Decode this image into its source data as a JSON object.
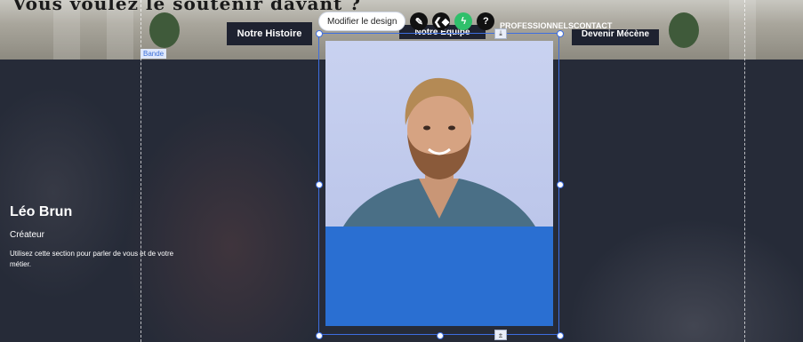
{
  "hero": {
    "title": "Vous voulez le soutenir davant ?"
  },
  "nav": {
    "history_label": "Notre Histoire",
    "team_label": "Notre Equipe",
    "pros_label": "PROFESSIONNELS",
    "contact_label": "CONTACT",
    "patron_label": "Devenir Mécène"
  },
  "editor": {
    "band_label": "Bande",
    "modify_design_label": "Modifier le design",
    "icons": [
      "pencil-icon",
      "animation-icon",
      "lightning-icon",
      "help-icon"
    ],
    "accent": "#3e6ee0"
  },
  "card": {
    "name": "Léo Brun",
    "role": "Créateur",
    "description": "Utilisez cette section pour parler de vous et de votre métier.",
    "bg_color": "#2a6fd2"
  }
}
